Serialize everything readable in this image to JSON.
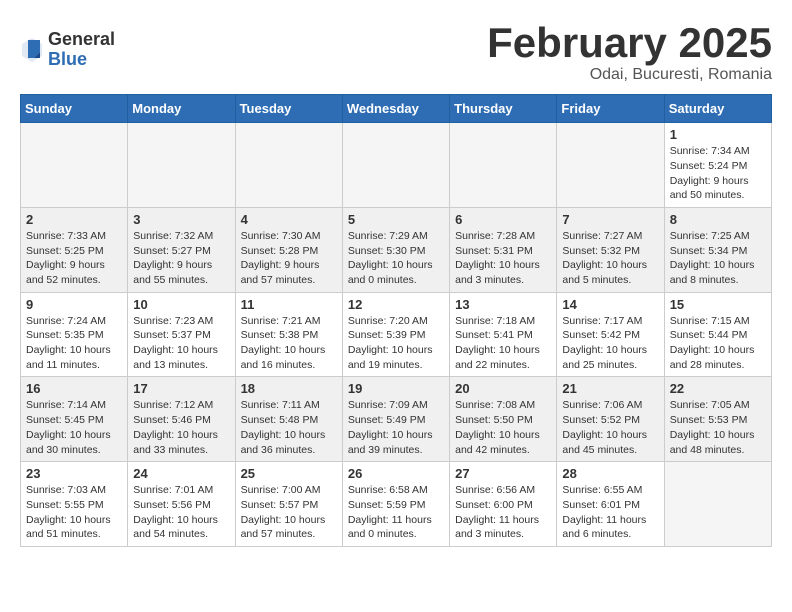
{
  "logo": {
    "general": "General",
    "blue": "Blue"
  },
  "title": "February 2025",
  "location": "Odai, Bucuresti, Romania",
  "headers": [
    "Sunday",
    "Monday",
    "Tuesday",
    "Wednesday",
    "Thursday",
    "Friday",
    "Saturday"
  ],
  "weeks": [
    {
      "shaded": false,
      "days": [
        {
          "num": "",
          "info": ""
        },
        {
          "num": "",
          "info": ""
        },
        {
          "num": "",
          "info": ""
        },
        {
          "num": "",
          "info": ""
        },
        {
          "num": "",
          "info": ""
        },
        {
          "num": "",
          "info": ""
        },
        {
          "num": "1",
          "info": "Sunrise: 7:34 AM\nSunset: 5:24 PM\nDaylight: 9 hours and 50 minutes."
        }
      ]
    },
    {
      "shaded": true,
      "days": [
        {
          "num": "2",
          "info": "Sunrise: 7:33 AM\nSunset: 5:25 PM\nDaylight: 9 hours and 52 minutes."
        },
        {
          "num": "3",
          "info": "Sunrise: 7:32 AM\nSunset: 5:27 PM\nDaylight: 9 hours and 55 minutes."
        },
        {
          "num": "4",
          "info": "Sunrise: 7:30 AM\nSunset: 5:28 PM\nDaylight: 9 hours and 57 minutes."
        },
        {
          "num": "5",
          "info": "Sunrise: 7:29 AM\nSunset: 5:30 PM\nDaylight: 10 hours and 0 minutes."
        },
        {
          "num": "6",
          "info": "Sunrise: 7:28 AM\nSunset: 5:31 PM\nDaylight: 10 hours and 3 minutes."
        },
        {
          "num": "7",
          "info": "Sunrise: 7:27 AM\nSunset: 5:32 PM\nDaylight: 10 hours and 5 minutes."
        },
        {
          "num": "8",
          "info": "Sunrise: 7:25 AM\nSunset: 5:34 PM\nDaylight: 10 hours and 8 minutes."
        }
      ]
    },
    {
      "shaded": false,
      "days": [
        {
          "num": "9",
          "info": "Sunrise: 7:24 AM\nSunset: 5:35 PM\nDaylight: 10 hours and 11 minutes."
        },
        {
          "num": "10",
          "info": "Sunrise: 7:23 AM\nSunset: 5:37 PM\nDaylight: 10 hours and 13 minutes."
        },
        {
          "num": "11",
          "info": "Sunrise: 7:21 AM\nSunset: 5:38 PM\nDaylight: 10 hours and 16 minutes."
        },
        {
          "num": "12",
          "info": "Sunrise: 7:20 AM\nSunset: 5:39 PM\nDaylight: 10 hours and 19 minutes."
        },
        {
          "num": "13",
          "info": "Sunrise: 7:18 AM\nSunset: 5:41 PM\nDaylight: 10 hours and 22 minutes."
        },
        {
          "num": "14",
          "info": "Sunrise: 7:17 AM\nSunset: 5:42 PM\nDaylight: 10 hours and 25 minutes."
        },
        {
          "num": "15",
          "info": "Sunrise: 7:15 AM\nSunset: 5:44 PM\nDaylight: 10 hours and 28 minutes."
        }
      ]
    },
    {
      "shaded": true,
      "days": [
        {
          "num": "16",
          "info": "Sunrise: 7:14 AM\nSunset: 5:45 PM\nDaylight: 10 hours and 30 minutes."
        },
        {
          "num": "17",
          "info": "Sunrise: 7:12 AM\nSunset: 5:46 PM\nDaylight: 10 hours and 33 minutes."
        },
        {
          "num": "18",
          "info": "Sunrise: 7:11 AM\nSunset: 5:48 PM\nDaylight: 10 hours and 36 minutes."
        },
        {
          "num": "19",
          "info": "Sunrise: 7:09 AM\nSunset: 5:49 PM\nDaylight: 10 hours and 39 minutes."
        },
        {
          "num": "20",
          "info": "Sunrise: 7:08 AM\nSunset: 5:50 PM\nDaylight: 10 hours and 42 minutes."
        },
        {
          "num": "21",
          "info": "Sunrise: 7:06 AM\nSunset: 5:52 PM\nDaylight: 10 hours and 45 minutes."
        },
        {
          "num": "22",
          "info": "Sunrise: 7:05 AM\nSunset: 5:53 PM\nDaylight: 10 hours and 48 minutes."
        }
      ]
    },
    {
      "shaded": false,
      "days": [
        {
          "num": "23",
          "info": "Sunrise: 7:03 AM\nSunset: 5:55 PM\nDaylight: 10 hours and 51 minutes."
        },
        {
          "num": "24",
          "info": "Sunrise: 7:01 AM\nSunset: 5:56 PM\nDaylight: 10 hours and 54 minutes."
        },
        {
          "num": "25",
          "info": "Sunrise: 7:00 AM\nSunset: 5:57 PM\nDaylight: 10 hours and 57 minutes."
        },
        {
          "num": "26",
          "info": "Sunrise: 6:58 AM\nSunset: 5:59 PM\nDaylight: 11 hours and 0 minutes."
        },
        {
          "num": "27",
          "info": "Sunrise: 6:56 AM\nSunset: 6:00 PM\nDaylight: 11 hours and 3 minutes."
        },
        {
          "num": "28",
          "info": "Sunrise: 6:55 AM\nSunset: 6:01 PM\nDaylight: 11 hours and 6 minutes."
        },
        {
          "num": "",
          "info": ""
        }
      ]
    }
  ]
}
